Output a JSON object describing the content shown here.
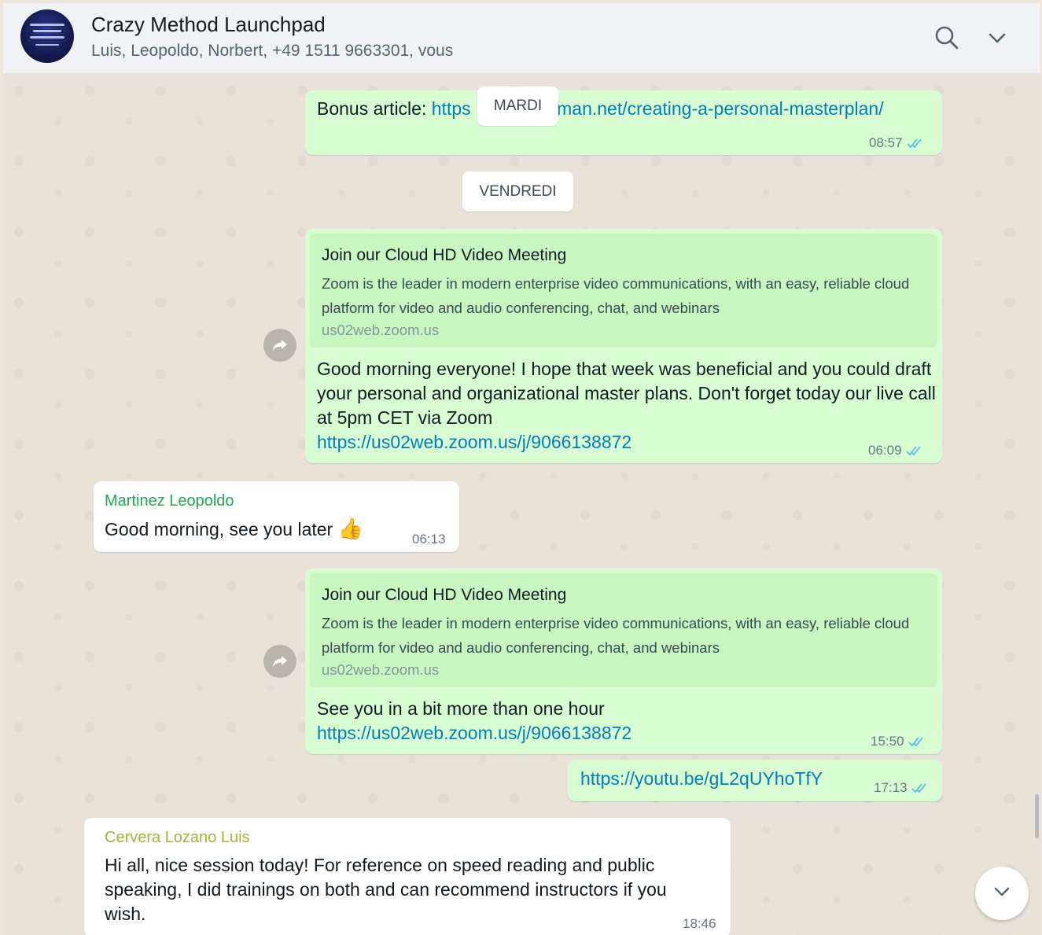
{
  "header": {
    "title": "Crazy Method Launchpad",
    "participants": "Luis, Leopoldo, Norbert, +49 1511 9663301, vous",
    "avatar_caption": "The Crazy Method Launchpad"
  },
  "date_chips": {
    "mardi": "MARDI",
    "vendredi": "VENDREDI"
  },
  "messages": {
    "m1": {
      "prefix": "Bonus article: ",
      "link_start": "https",
      "link_end": "ifman.net/creating-a-personal-masterplan/",
      "time": "08:57"
    },
    "m2": {
      "preview_title": "Join our Cloud HD Video Meeting",
      "preview_desc": "Zoom is the leader in modern enterprise video communications, with an easy, reliable cloud platform for video and audio conferencing, chat, and webinars",
      "preview_domain": "us02web.zoom.us",
      "text": "Good morning everyone!  I hope that week was beneficial and you could draft your personal and organizational master plans.  Don't forget today our live call at 5pm CET via Zoom",
      "link": "https://us02web.zoom.us/j/9066138872",
      "time": "06:09"
    },
    "m3": {
      "sender": "Martinez Leopoldo",
      "sender_color": "#1fa855",
      "text": "Good morning, see you later",
      "emoji": "👍",
      "time": "06:13"
    },
    "m4": {
      "preview_title": "Join our Cloud HD Video Meeting",
      "preview_desc": "Zoom is the leader in modern enterprise video communications, with an easy, reliable cloud platform for video and audio conferencing, chat, and webinars",
      "preview_domain": "us02web.zoom.us",
      "text": "See you in a bit more than one hour",
      "link": "https://us02web.zoom.us/j/9066138872",
      "time": "15:50"
    },
    "m5": {
      "link": "https://youtu.be/gL2qUYhoTfY",
      "time": "17:13"
    },
    "m6": {
      "sender": "Cervera Lozano Luis",
      "sender_color": "#a5b337",
      "text": "Hi all, nice session today! For reference on speed reading and public speaking, I did trainings on both and can recommend instructors if you wish.",
      "time": "18:46"
    }
  },
  "icons": {
    "search": "search-icon",
    "menu": "chevron-down-icon",
    "forward": "forward-icon",
    "read": "double-check-icon",
    "scroll": "chevron-down-icon"
  },
  "colors": {
    "outgoing_bubble": "#d9fdd3",
    "incoming_bubble": "#ffffff",
    "link": "#027eb5",
    "read_tick": "#53bdeb"
  }
}
